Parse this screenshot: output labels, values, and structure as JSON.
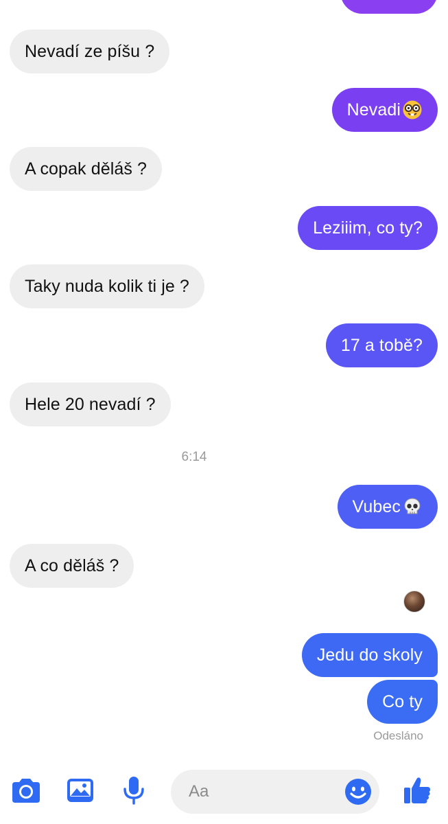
{
  "colors": {
    "incoming_bg": "#eeeeee",
    "outgoing_purple": "#7b3ff2",
    "outgoing_violet": "#6a4af5",
    "outgoing_blue": "#4d5ff5",
    "outgoing_blue2": "#3b6cf4",
    "accent_blue": "#2f6bf2"
  },
  "messages": [
    {
      "direction": "in",
      "text": "Nevadí ze píšu ?"
    },
    {
      "direction": "out",
      "text": "Nevadi",
      "emoji": "nerd-face-icon"
    },
    {
      "direction": "in",
      "text": "A copak děláš ?"
    },
    {
      "direction": "out",
      "text": "Leziiim, co ty?"
    },
    {
      "direction": "in",
      "text": "Taky nuda kolik ti je ?"
    },
    {
      "direction": "out",
      "text": "17 a tobě?"
    },
    {
      "direction": "in",
      "text": "Hele 20 nevadí ?"
    },
    {
      "direction": "out",
      "text": "Vubec",
      "emoji": "skull-icon"
    },
    {
      "direction": "in",
      "text": "A co děláš ?"
    },
    {
      "direction": "out",
      "text": "Jedu do skoly"
    },
    {
      "direction": "out",
      "text": "Co ty"
    }
  ],
  "timestamp": "6:14",
  "status": "Odesláno",
  "composer": {
    "placeholder": "Aa",
    "icons": [
      "camera-icon",
      "gallery-icon",
      "microphone-icon",
      "emoji-icon",
      "like-icon"
    ]
  }
}
